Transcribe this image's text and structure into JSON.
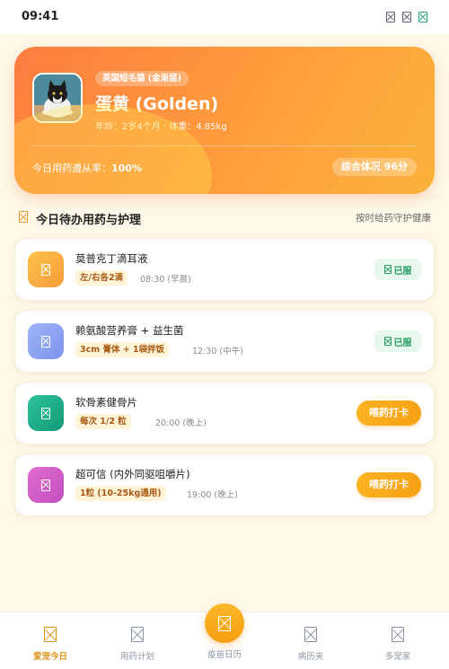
{
  "status_bar": {
    "time": "09:41"
  },
  "pet": {
    "breed_badge": "英国短毛猫 (金渐层)",
    "name": "蛋黄 (Golden)",
    "meta": "年龄：2岁4个月 · 体重：4.85kg",
    "adherence_label": "今日用药遵从率：",
    "adherence_value": "100%",
    "health_score": "综合体况 96分"
  },
  "section": {
    "title": "今日待办用药与护理",
    "link": "按时给药守护健康"
  },
  "medications": [
    {
      "name": "莫普克丁滴耳液",
      "dose": "左/右各2滴",
      "time": "08:30 (早晨)",
      "status": "done",
      "status_label": "已服",
      "icon_color": "#fbb040"
    },
    {
      "name": "赖氨酸营养膏 + 益生菌",
      "dose": "3cm 膏体 + 1袋拌饭",
      "time": "12:30 (中午)",
      "status": "done",
      "status_label": "已服",
      "icon_color": "#8aa3f5"
    },
    {
      "name": "软骨素健骨片",
      "dose": "每次 1/2 粒",
      "time": "20:00 (晚上)",
      "status": "pending",
      "status_label": "喂药打卡",
      "icon_color": "#22b28c"
    },
    {
      "name": "超可信 (内外同驱咀嚼片)",
      "dose": "1粒 (10-25kg通用)",
      "time": "19:00 (晚上)",
      "status": "pending",
      "status_label": "喂药打卡",
      "icon_color": "#d45fc8"
    }
  ],
  "nav": {
    "items": [
      {
        "label": "爱宠今日",
        "icon": "paw-icon",
        "active": true
      },
      {
        "label": "用药计划",
        "icon": "pill-icon",
        "active": false
      },
      {
        "label": "疫苗日历",
        "icon": "calendar-icon",
        "active": false
      },
      {
        "label": "病历夹",
        "icon": "folder-icon",
        "active": false
      },
      {
        "label": "多宠家",
        "icon": "pets-icon",
        "active": false
      }
    ]
  },
  "colors": {
    "accent": "#f7a114",
    "hero_start": "#fc7d3f",
    "hero_end": "#fbb33b",
    "done_green": "#2a9d63",
    "background": "#fdf8e8"
  }
}
